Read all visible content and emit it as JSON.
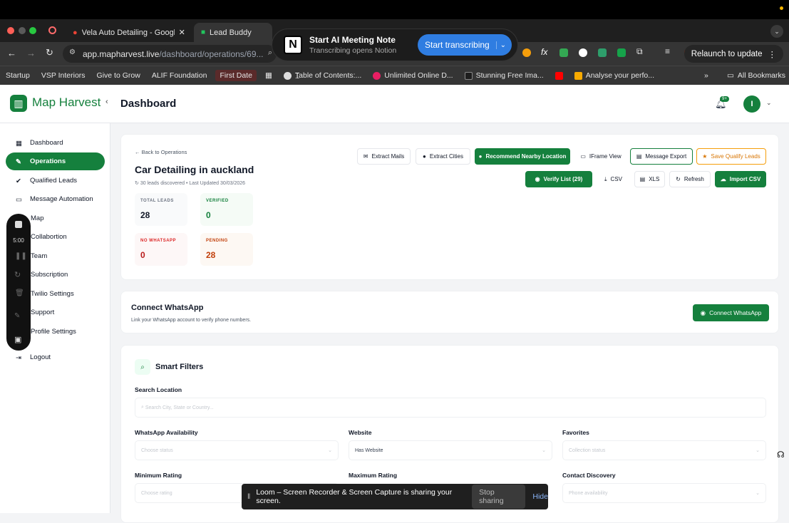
{
  "browser": {
    "tabs": [
      {
        "label": "Vela Auto Detailing - Google I",
        "active": false
      },
      {
        "label": "Lead Buddy",
        "active": true
      }
    ],
    "url_main": "app.mapharvest.live",
    "url_path": "/dashboard/operations/69...",
    "relaunch_label": "Relaunch to update",
    "bookmarks": [
      "Startup",
      "VSP Interiors",
      "Give to Grow",
      "ALIF Foundation",
      "First Date",
      "Table of Contents:...",
      "Unlimited Online D...",
      "Stunning Free Ima...",
      "Analyse your perfo..."
    ],
    "all_bookmarks": "All Bookmarks"
  },
  "notion_popup": {
    "title": "Start AI Meeting Note",
    "subtitle": "Transcribing opens Notion",
    "button": "Start transcribing"
  },
  "app": {
    "name": "Map Harvest",
    "page_title": "Dashboard",
    "notif_count": "9+",
    "avatar_initial": "I"
  },
  "sidebar": {
    "items": [
      {
        "label": "Dashboard",
        "icon": "grid-icon"
      },
      {
        "label": "Operations",
        "icon": "wrench-icon"
      },
      {
        "label": "Qualified Leads",
        "icon": "check-circle-icon"
      },
      {
        "label": "Message Automation",
        "icon": "message-icon"
      },
      {
        "label": "Map",
        "icon": "map-icon"
      },
      {
        "label": "Collabortion",
        "icon": "users-icon"
      },
      {
        "label": "Team",
        "icon": "team-icon"
      },
      {
        "label": "Subscription",
        "icon": "card-icon"
      },
      {
        "label": "Twilio Settings",
        "icon": "phone-icon"
      },
      {
        "label": "Support",
        "icon": "help-icon"
      },
      {
        "label": "Profile Settings",
        "icon": "user-icon"
      },
      {
        "label": "Logout",
        "icon": "logout-icon"
      }
    ],
    "loom_timer": "5:00"
  },
  "operation": {
    "back_label": "Back to Operations",
    "title": "Car Detailing in auckland",
    "meta": "30 leads discovered • Last Updated 30/03/2026",
    "buttons_row1": [
      "Extract Mails",
      "Extract Cities",
      "Recommend Nearby Location",
      "IFrame View",
      "Message Export",
      "Save Qualify Leads"
    ],
    "buttons_row2": [
      "Verify List (29)",
      "CSV",
      "XLS",
      "Refresh",
      "Import CSV"
    ],
    "stats": [
      {
        "label": "TOTAL LEADS",
        "value": "28",
        "color": "#111827"
      },
      {
        "label": "VERIFIED",
        "value": "0",
        "color": "#15803d"
      },
      {
        "label": "NO WHATSAPP",
        "value": "0",
        "color": "#dc2626"
      },
      {
        "label": "PENDING",
        "value": "28",
        "color": "#c2410c"
      }
    ]
  },
  "whatsapp": {
    "title": "Connect WhatsApp",
    "subtitle": "Link your WhatsApp account to verify phone numbers.",
    "button": "Connect WhatsApp"
  },
  "filters": {
    "title": "Smart Filters",
    "search_label": "Search Location",
    "search_placeholder": "Search City, State or Country...",
    "fields": [
      {
        "label": "WhatsApp Availability",
        "value": "Choose status"
      },
      {
        "label": "Website",
        "value": "Has Website"
      },
      {
        "label": "Favorites",
        "value": "Collection status"
      },
      {
        "label": "Minimum Rating",
        "value": "Choose rating"
      },
      {
        "label": "Maximum Rating",
        "value": ""
      },
      {
        "label": "Contact Discovery",
        "value": "Phone availability"
      }
    ]
  },
  "loom_bar": {
    "text": "Loom – Screen Recorder & Screen Capture is sharing your screen.",
    "stop": "Stop sharing",
    "hide": "Hide"
  },
  "colors": {
    "brand": "#15803d"
  }
}
